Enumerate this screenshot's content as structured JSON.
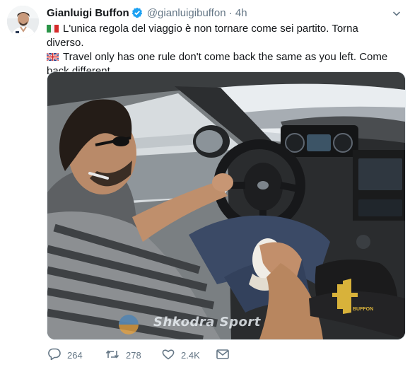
{
  "tweet": {
    "author_name": "Gianluigi Buffon",
    "handle": "@gianluigibuffon",
    "separator": "·",
    "time": "4h",
    "text_it": "L'unica regola del viaggio è non tornare come sei partito. Torna diverso.",
    "text_en": "Travel only has one rule don't come back the same as you left. Come back different.",
    "media": {
      "watermark": "Shkodra Sport",
      "cap_text": "BUFFON"
    },
    "actions": {
      "replies": "264",
      "retweets": "278",
      "likes": "2.4K"
    }
  },
  "colors": {
    "text_primary": "#14171a",
    "text_secondary": "#657786",
    "verified": "#1da1f2",
    "cap_gold": "#d8b23a"
  },
  "icons": [
    "verified-badge-icon",
    "caret-down-icon",
    "italy-flag-icon",
    "uk-flag-icon",
    "reply-icon",
    "retweet-icon",
    "like-icon",
    "direct-message-icon"
  ]
}
